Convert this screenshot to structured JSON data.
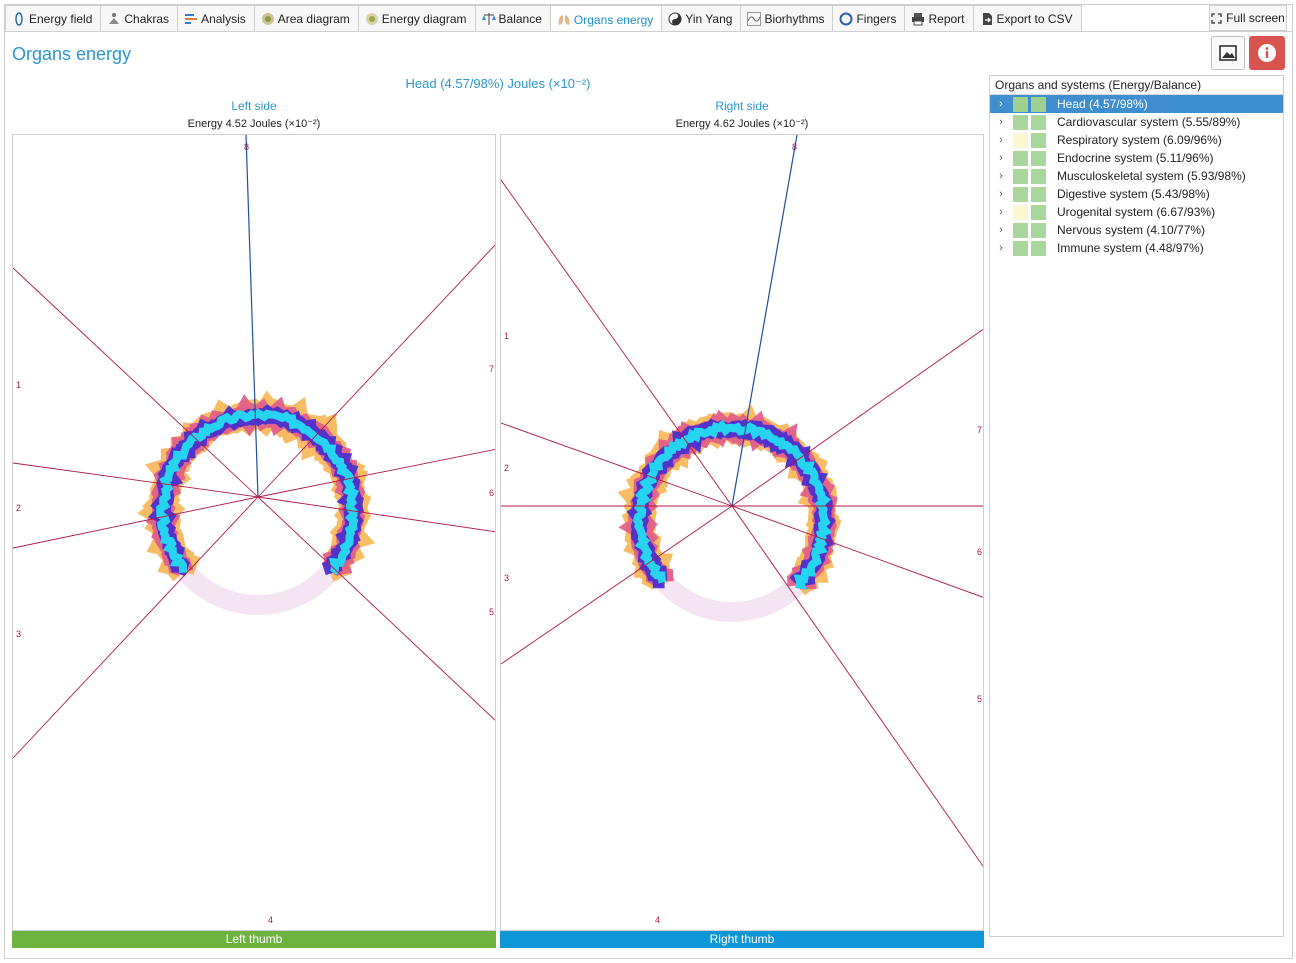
{
  "tabs": [
    {
      "label": "Energy field",
      "icon": "energy-field-icon"
    },
    {
      "label": "Chakras",
      "icon": "chakras-icon"
    },
    {
      "label": "Analysis",
      "icon": "analysis-icon"
    },
    {
      "label": "Area diagram",
      "icon": "area-diagram-icon"
    },
    {
      "label": "Energy diagram",
      "icon": "energy-diagram-icon"
    },
    {
      "label": "Balance",
      "icon": "balance-icon"
    },
    {
      "label": "Organs energy",
      "icon": "organs-icon",
      "active": true
    },
    {
      "label": "Yin Yang",
      "icon": "yin-yang-icon"
    },
    {
      "label": "Biorhythms",
      "icon": "biorhythms-icon"
    },
    {
      "label": "Fingers",
      "icon": "fingers-icon"
    },
    {
      "label": "Report",
      "icon": "printer-icon"
    },
    {
      "label": "Export to CSV",
      "icon": "export-icon"
    }
  ],
  "fullscreen_label": "Full screen",
  "page_title": "Organs energy",
  "head_title": "Head (4.57/98%) Joules (×10⁻²)",
  "left": {
    "side_title": "Left side",
    "energy": "Energy 4.52 Joules (×10⁻²)",
    "thumb": "Left thumb",
    "labels": [
      "8",
      "1",
      "2",
      "3",
      "4",
      "5",
      "6",
      "7"
    ]
  },
  "right": {
    "side_title": "Right side",
    "energy": "Energy 4.62 Joules (×10⁻²)",
    "thumb": "Right thumb",
    "labels": [
      "8",
      "1",
      "2",
      "3",
      "4",
      "5",
      "6",
      "7"
    ]
  },
  "tree": {
    "header": "Organs and systems (Energy/Balance)",
    "items": [
      {
        "label": "Head (4.57/98%)",
        "c1": "#9fd08f",
        "c2": "#9fd08f",
        "selected": true
      },
      {
        "label": "Cardiovascular system (5.55/89%)",
        "c1": "#a9d79b",
        "c2": "#a9d79b"
      },
      {
        "label": "Respiratory system (6.09/96%)",
        "c1": "#fbf7d2",
        "c2": "#a9d79b"
      },
      {
        "label": "Endocrine system (5.11/96%)",
        "c1": "#a9d79b",
        "c2": "#a9d79b"
      },
      {
        "label": "Musculoskeletal system (5.93/98%)",
        "c1": "#a9d79b",
        "c2": "#a9d79b"
      },
      {
        "label": "Digestive system (5.43/98%)",
        "c1": "#a9d79b",
        "c2": "#a9d79b"
      },
      {
        "label": "Urogenital system (6.67/93%)",
        "c1": "#fbf7d2",
        "c2": "#a9d79b"
      },
      {
        "label": "Nervous system (4.10/77%)",
        "c1": "#a9d79b",
        "c2": "#a9d79b"
      },
      {
        "label": "Immune system (4.48/97%)",
        "c1": "#a9d79b",
        "c2": "#a9d79b"
      }
    ]
  },
  "colors": {
    "accent": "#2a98cf",
    "left_thumb": "#6db33f",
    "right_thumb": "#0e96d6",
    "info": "#d9534f",
    "sector_line": "#b0174b",
    "head_line": "#1f4f9c"
  }
}
